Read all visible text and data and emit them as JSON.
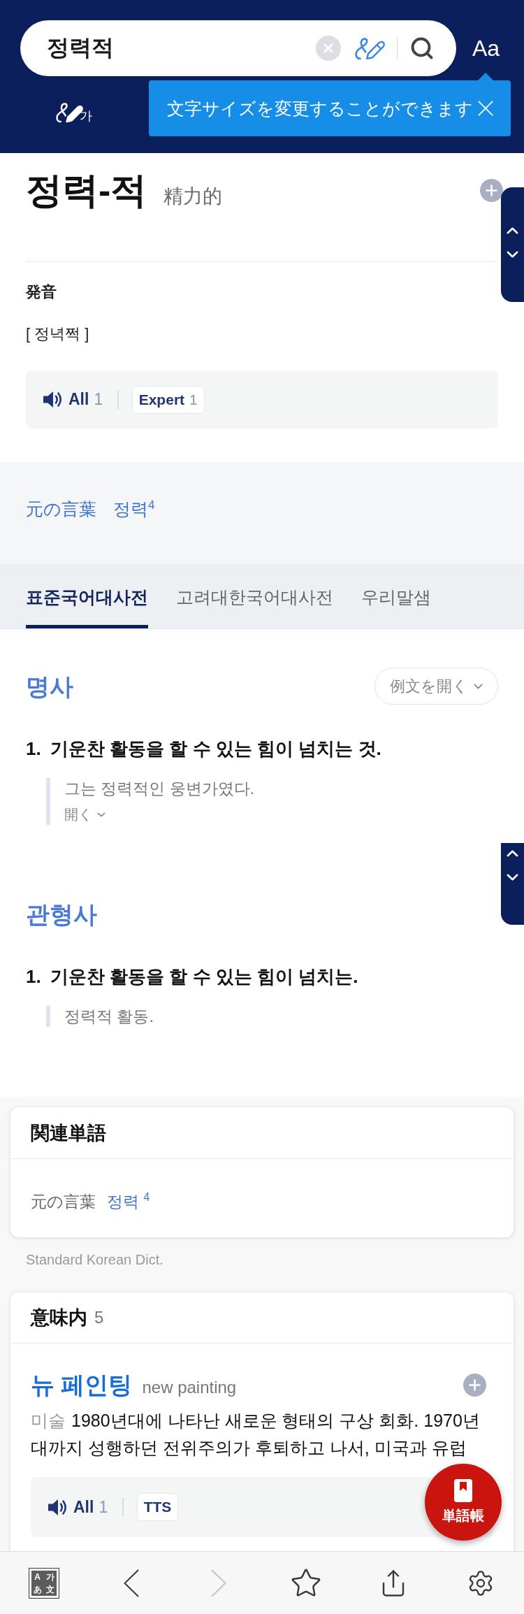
{
  "search": {
    "value": "정력적"
  },
  "font_size_button": "Aa",
  "handwriting_button": "가",
  "tooltip": {
    "text": "文字サイズを変更することができます"
  },
  "entry": {
    "headword": "정력-적",
    "hanja": "精力的",
    "pronunciation_heading": "発音",
    "pronunciation": "[ 정녁쩍 ]",
    "audio": {
      "all_label": "All",
      "all_count": "1",
      "chips": [
        {
          "label": "Expert",
          "count": "1"
        }
      ]
    }
  },
  "origin": {
    "label": "元の言葉",
    "word": "정력$^{4}$"
  },
  "tabs": [
    {
      "label": "표준국어대사전",
      "selected": true
    },
    {
      "label": "고려대한국어대사전",
      "selected": false
    },
    {
      "label": "우리말샘",
      "selected": false
    }
  ],
  "senses": [
    {
      "pos": "명사",
      "toggle": "例文を開く",
      "definitions": [
        {
          "number": "1.",
          "text": "기운찬 활동을 할 수 있는 힘이 넘치는 것.",
          "examples": [
            "그는 정력적인 웅변가였다."
          ],
          "more": "開く"
        }
      ]
    },
    {
      "pos": "관형사",
      "definitions": [
        {
          "number": "1.",
          "text": "기운찬 활동을 할 수 있는 힘이 넘치는.",
          "examples": [
            "정력적 활동."
          ]
        }
      ]
    }
  ],
  "related": {
    "title": "関連単語",
    "items": [
      {
        "label": "元の言葉",
        "word": "정력 $^{4}$"
      }
    ]
  },
  "source": "Standard Korean Dict.",
  "meanings": {
    "title": "意味内",
    "count": "5",
    "items": [
      {
        "word": "뉴 페인팅",
        "gloss": "new painting",
        "field": "미술",
        "definition": "1980년대에 나타난 새로운 형태의 구상 회화. 1970년대까지 성행하던 전위주의가 후퇴하고 나서, 미국과 유럽",
        "audio": {
          "all_label": "All",
          "all_count": "1",
          "chips": [
            {
              "label": "TTS"
            }
          ]
        }
      }
    ]
  },
  "wordbook_button": "単語帳",
  "bottom_nav": [
    {
      "kind": "translate",
      "glyphs": [
        "A",
        "가",
        "あ",
        "文"
      ],
      "disabled": false
    },
    {
      "kind": "back",
      "disabled": false
    },
    {
      "kind": "forward",
      "disabled": true
    },
    {
      "kind": "favorite",
      "disabled": false
    },
    {
      "kind": "share",
      "disabled": false
    },
    {
      "kind": "settings",
      "disabled": false
    }
  ]
}
